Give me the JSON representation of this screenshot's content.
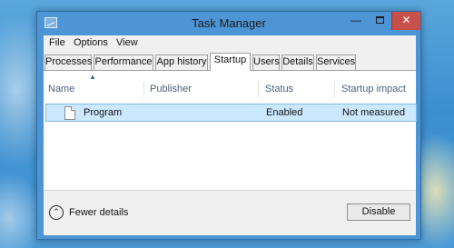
{
  "window": {
    "title": "Task Manager"
  },
  "menu": [
    "File",
    "Options",
    "View"
  ],
  "tabs": [
    {
      "label": "Processes"
    },
    {
      "label": "Performance"
    },
    {
      "label": "App history"
    },
    {
      "label": "Startup"
    },
    {
      "label": "Users"
    },
    {
      "label": "Details"
    },
    {
      "label": "Services"
    }
  ],
  "active_tab": "Startup",
  "columns": [
    "Name",
    "Publisher",
    "Status",
    "Startup impact"
  ],
  "rows": [
    {
      "name": "Program",
      "publisher": "",
      "status": "Enabled",
      "impact": "Not measured"
    }
  ],
  "footer": {
    "fewer_details": "Fewer details",
    "disable": "Disable"
  },
  "icons": {
    "app": "task-manager-icon",
    "minimize": "minimize-icon",
    "maximize": "maximize-icon",
    "close": "close-icon",
    "row": "document-icon",
    "fewer": "chevron-up-icon"
  },
  "colors": {
    "titlebar": "#4d95d4",
    "close": "#c7504a",
    "selection": "#cce8ff"
  }
}
